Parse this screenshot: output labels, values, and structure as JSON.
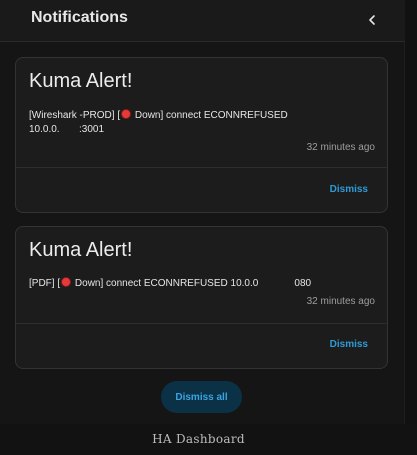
{
  "header": {
    "title": "Notifications",
    "close_icon": "chevron-left-icon"
  },
  "notifications": [
    {
      "title": "Kuma Alert!",
      "message_pre": "[Wireshark -PROD] [",
      "message_status": "Down] connect ECONNREFUSED",
      "message_line2": "10.0.0.       :3001",
      "time": "32 minutes ago",
      "dismiss_label": "Dismiss"
    },
    {
      "title": "Kuma Alert!",
      "message_pre": "[PDF] [",
      "message_status": "Down] connect ECONNREFUSED 10.0.0             080",
      "time": "32 minutes ago",
      "dismiss_label": "Dismiss"
    }
  ],
  "dismiss_all_label": "Dismiss all",
  "footer": {
    "label": "HA Dashboard"
  },
  "colors": {
    "accent": "#2e9bd6",
    "status_down": "#e53a3a"
  }
}
